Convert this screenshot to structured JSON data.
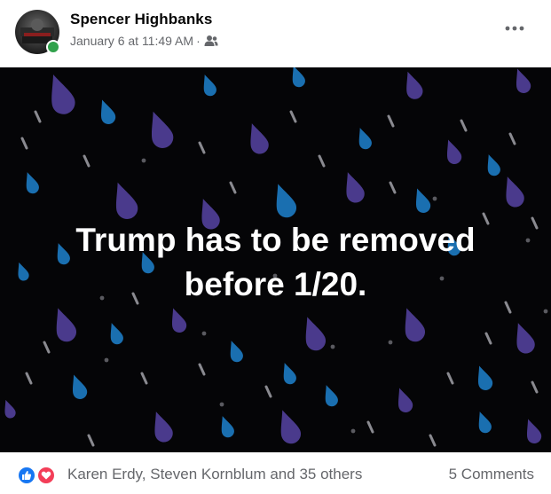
{
  "author": {
    "name": "Spencer Highbanks",
    "online": true
  },
  "post_meta": {
    "timestamp": "January 6 at 11:49 AM",
    "separator": "·",
    "audience_icon": "friends-icon"
  },
  "more_icon": "more-horizontal-icon",
  "post_text": {
    "line1": "Trump has to be removed",
    "line2": "before 1/20."
  },
  "background": {
    "color": "#050507",
    "drop_colors": [
      "#4a3a8c",
      "#1a6fb0",
      "#8a8a90"
    ]
  },
  "reactions": {
    "icons": [
      "like-icon",
      "love-icon"
    ],
    "colors": {
      "like": "#1877f2",
      "love": "#f33e58"
    },
    "summary": "Karen Erdy, Steven Kornblum and 35 others"
  },
  "comments": {
    "label": "5 Comments"
  }
}
